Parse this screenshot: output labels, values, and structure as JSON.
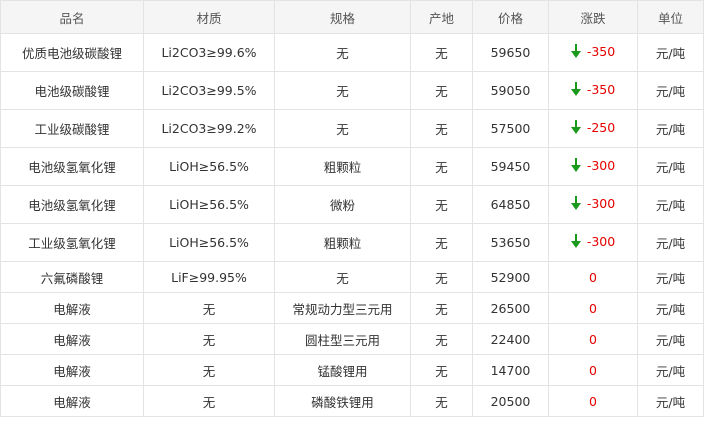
{
  "colors": {
    "down_arrow": "#1a9a1a",
    "change_text": "#e60000",
    "header_bg": "#f5f5f5",
    "border": "#e3e3e3"
  },
  "table": {
    "headers": [
      "品名",
      "材质",
      "规格",
      "产地",
      "价格",
      "涨跌",
      "单位"
    ],
    "rows": [
      {
        "name": "优质电池级碳酸锂",
        "material": "Li2CO3≥99.6%",
        "spec": "无",
        "origin": "无",
        "price": "59650",
        "change": "-350",
        "direction": "down",
        "unit": "元/吨"
      },
      {
        "name": "电池级碳酸锂",
        "material": "Li2CO3≥99.5%",
        "spec": "无",
        "origin": "无",
        "price": "59050",
        "change": "-350",
        "direction": "down",
        "unit": "元/吨"
      },
      {
        "name": "工业级碳酸锂",
        "material": "Li2CO3≥99.2%",
        "spec": "无",
        "origin": "无",
        "price": "57500",
        "change": "-250",
        "direction": "down",
        "unit": "元/吨"
      },
      {
        "name": "电池级氢氧化锂",
        "material": "LiOH≥56.5%",
        "spec": "粗颗粒",
        "origin": "无",
        "price": "59450",
        "change": "-300",
        "direction": "down",
        "unit": "元/吨"
      },
      {
        "name": "电池级氢氧化锂",
        "material": "LiOH≥56.5%",
        "spec": "微粉",
        "origin": "无",
        "price": "64850",
        "change": "-300",
        "direction": "down",
        "unit": "元/吨"
      },
      {
        "name": "工业级氢氧化锂",
        "material": "LiOH≥56.5%",
        "spec": "粗颗粒",
        "origin": "无",
        "price": "53650",
        "change": "-300",
        "direction": "down",
        "unit": "元/吨"
      },
      {
        "name": "六氟磷酸锂",
        "material": "LiF≥99.95%",
        "spec": "无",
        "origin": "无",
        "price": "52900",
        "change": "0",
        "direction": "flat",
        "unit": "元/吨"
      },
      {
        "name": "电解液",
        "material": "无",
        "spec": "常规动力型三元用",
        "origin": "无",
        "price": "26500",
        "change": "0",
        "direction": "flat",
        "unit": "元/吨"
      },
      {
        "name": "电解液",
        "material": "无",
        "spec": "圆柱型三元用",
        "origin": "无",
        "price": "22400",
        "change": "0",
        "direction": "flat",
        "unit": "元/吨"
      },
      {
        "name": "电解液",
        "material": "无",
        "spec": "锰酸锂用",
        "origin": "无",
        "price": "14700",
        "change": "0",
        "direction": "flat",
        "unit": "元/吨"
      },
      {
        "name": "电解液",
        "material": "无",
        "spec": "磷酸铁锂用",
        "origin": "无",
        "price": "20500",
        "change": "0",
        "direction": "flat",
        "unit": "元/吨"
      }
    ]
  }
}
